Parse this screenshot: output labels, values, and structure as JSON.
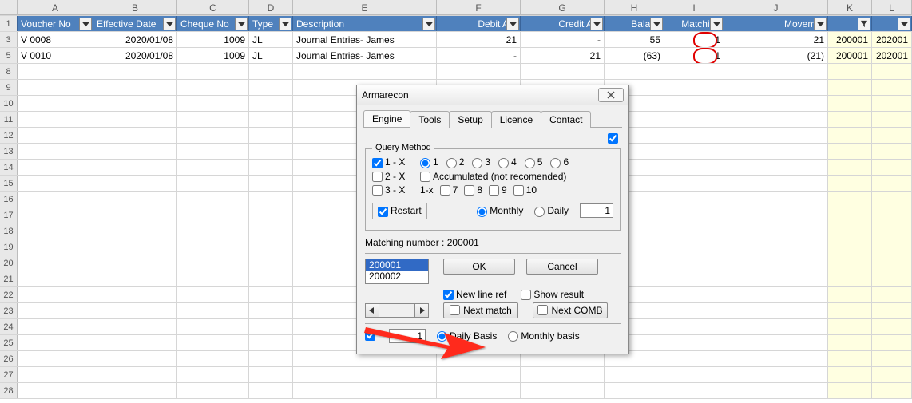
{
  "columns": {
    "A": "A",
    "B": "B",
    "C": "C",
    "D": "D",
    "E": "E",
    "F": "F",
    "G": "G",
    "H": "H",
    "I": "I",
    "J": "J",
    "K": "K",
    "L": "L"
  },
  "header": {
    "A": "Voucher No",
    "B": "Effective Date",
    "C": "Cheque No",
    "D": "Type",
    "E": "Description",
    "F": "Debit Am",
    "G": "Credit Am",
    "H": "Balanc",
    "I": "Matching",
    "J": "Movemer",
    "K": "",
    "L": ""
  },
  "row_labels": {
    "hdr": "1",
    "r1": "3",
    "r2": "5",
    "r3": "8",
    "r4": "9",
    "r5": "10",
    "r6": "11",
    "r7": "12",
    "r8": "13",
    "r9": "14",
    "r10": "15",
    "r11": "16",
    "r12": "17",
    "r13": "18",
    "r14": "19",
    "r15": "20",
    "r16": "21",
    "r17": "22",
    "r18": "23",
    "r19": "24",
    "r20": "25",
    "r21": "26",
    "r22": "27",
    "r23": "28"
  },
  "data": {
    "r1": {
      "A": "V 0008",
      "B": "2020/01/08",
      "C": "1009",
      "D": "JL",
      "E": "Journal Entries- James",
      "F": "21",
      "G": "-",
      "H": "55",
      "I": "1",
      "J": "21",
      "K": "200001",
      "L": "202001"
    },
    "r2": {
      "A": "V 0010",
      "B": "2020/01/08",
      "C": "1009",
      "D": "JL",
      "E": "Journal Entries- James",
      "F": "-",
      "G": "21",
      "H": "(63)",
      "I": "1",
      "J": "(21)",
      "K": "200001",
      "L": "202001"
    }
  },
  "dialog": {
    "title": "Armarecon",
    "tabs": {
      "engine": "Engine",
      "tools": "Tools",
      "setup": "Setup",
      "licence": "Licence",
      "contact": "Contact"
    },
    "queryMethod": {
      "legend": "Query Method",
      "opt1": "1 - X",
      "opt2": "2 - X",
      "opt3": "3 - X"
    },
    "numPrefix": "1-x",
    "nums": {
      "n1": "1",
      "n2": "2",
      "n3": "3",
      "n4": "4",
      "n5": "5",
      "n6": "6",
      "n7": "7",
      "n8": "8",
      "n9": "9",
      "n10": "10"
    },
    "accum": "Accumulated (not recomended)",
    "restart": "Restart",
    "monthly": "Monthly",
    "daily": "Daily",
    "monthlyVal": "1",
    "matchingLbl": "Matching number : 200001",
    "list": {
      "sel": "200001",
      "other": "200002"
    },
    "ok": "OK",
    "cancel": "Cancel",
    "newline": "New line ref",
    "showres": "Show result",
    "nextmatch": "Next match",
    "nextcomb": "Next COMB",
    "basisVal": "1",
    "dailyBasis": "Daily Basis",
    "monthlyBasis": "Monthly basis"
  }
}
